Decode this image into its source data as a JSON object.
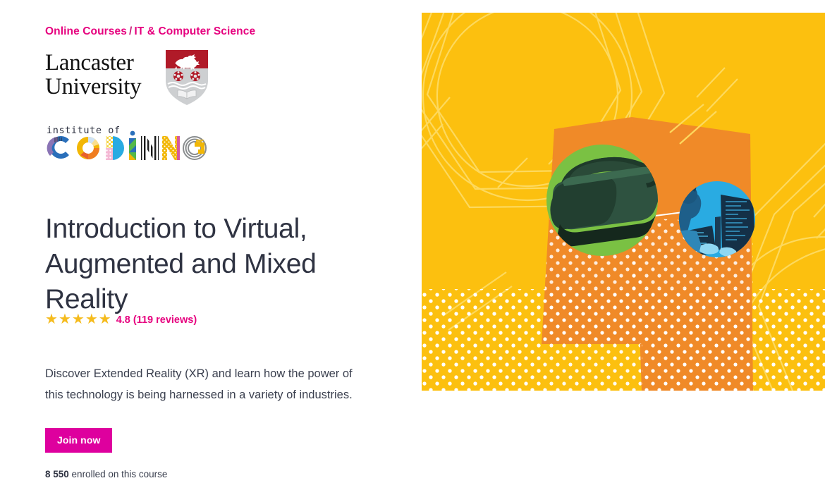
{
  "breadcrumb": {
    "items": [
      {
        "label": "Online Courses"
      },
      {
        "label": "IT & Computer Science"
      }
    ],
    "separator": "/",
    "color": "#e6007e"
  },
  "provider": {
    "university_logo": {
      "line1": "Lancaster",
      "line2": "University",
      "crest_name": "lancaster-university-crest",
      "crest_colors": {
        "shield_red": "#b01a28",
        "shield_grey": "#c9cacc"
      }
    },
    "partner_logo": {
      "top_text": "institute of",
      "main_text": "CODING",
      "letters": [
        {
          "char": "C",
          "colors": [
            "#8a74b5",
            "#2a6fba"
          ]
        },
        {
          "char": "O",
          "colors": [
            "#f2b705",
            "#f07d20"
          ]
        },
        {
          "char": "D",
          "colors": [
            "#29abe2",
            "#f5d547"
          ]
        },
        {
          "char": "I",
          "colors": [
            "#2a6fba",
            "#56b949"
          ]
        },
        {
          "char": "N",
          "colors": [
            "#1a1a1a",
            "#ffffff"
          ]
        },
        {
          "char": "I2",
          "colors": [
            "#d4599f",
            "#f2b705"
          ]
        },
        {
          "char": "N2",
          "colors": [
            "#d4599f",
            "#f2b705"
          ]
        },
        {
          "char": "G",
          "colors": [
            "#f2b705",
            "#9a9a9a"
          ]
        }
      ]
    }
  },
  "course": {
    "title": "Introduction to Virtual, Augmented and Mixed Reality",
    "description": "Discover Extended Reality (XR) and learn how the power of this technology is being harnessed in a variety of industries.",
    "rating": {
      "score": "4.8",
      "reviews_count": "119",
      "label": "4.8 (119 reviews)",
      "stars_filled": 5,
      "stars_total": 5,
      "star_glyph": "★",
      "star_color": "#f5bb1d"
    },
    "cta": {
      "label": "Join now",
      "background": "#de009e",
      "text_color": "#ffffff"
    },
    "enrollment": {
      "count": "8 550",
      "suffix": " enrolled on this course"
    }
  },
  "hero": {
    "alt_name": "course-hero-illustration",
    "background_color": "#fcc00f",
    "accent_orange": "#f08a28",
    "circle_green": "#7ac143",
    "circle_blue": "#29abe2",
    "headset_dark": "#23402f",
    "coder_dark": "#153248",
    "line_color": "#fdd95e",
    "dot_color": "#ffffff",
    "elements": [
      {
        "name": "vr-headset-photo-circle",
        "color": "#7ac143"
      },
      {
        "name": "coding-photo-circle",
        "color": "#29abe2"
      },
      {
        "name": "orange-polygon",
        "color": "#f08a28"
      },
      {
        "name": "hexagon-line-pattern",
        "color": "#fdd95e"
      },
      {
        "name": "dot-grid-pattern",
        "color": "#ffffff"
      }
    ]
  }
}
